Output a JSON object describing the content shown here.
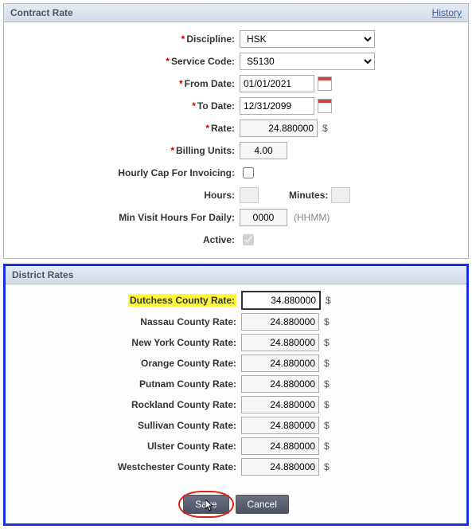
{
  "contract": {
    "title": "Contract Rate",
    "history_link": "History",
    "labels": {
      "discipline": "Discipline:",
      "service_code": "Service Code:",
      "from_date": "From Date:",
      "to_date": "To Date:",
      "rate": "Rate:",
      "billing_units": "Billing Units:",
      "hourly_cap": "Hourly Cap For Invoicing:",
      "hours": "Hours:",
      "minutes": "Minutes:",
      "min_visit": "Min Visit Hours For Daily:",
      "active": "Active:"
    },
    "values": {
      "discipline": "HSK",
      "service_code": "S5130",
      "from_date": "01/01/2021",
      "to_date": "12/31/2099",
      "rate": "24.880000",
      "billing_units": "4.00",
      "min_visit": "0000"
    },
    "hints": {
      "min_visit": "(HHMM)"
    },
    "unit_dollar": "$"
  },
  "district": {
    "title": "District Rates",
    "rows": [
      {
        "label": "Dutchess County Rate:",
        "value": "34.880000",
        "highlight": true
      },
      {
        "label": "Nassau County Rate:",
        "value": "24.880000"
      },
      {
        "label": "New York County Rate:",
        "value": "24.880000"
      },
      {
        "label": "Orange County Rate:",
        "value": "24.880000"
      },
      {
        "label": "Putnam County Rate:",
        "value": "24.880000"
      },
      {
        "label": "Rockland County Rate:",
        "value": "24.880000"
      },
      {
        "label": "Sullivan County Rate:",
        "value": "24.880000"
      },
      {
        "label": "Ulster County Rate:",
        "value": "24.880000"
      },
      {
        "label": "Westchester County Rate:",
        "value": "24.880000"
      }
    ],
    "unit_dollar": "$"
  },
  "buttons": {
    "save": "Save",
    "cancel": "Cancel"
  }
}
